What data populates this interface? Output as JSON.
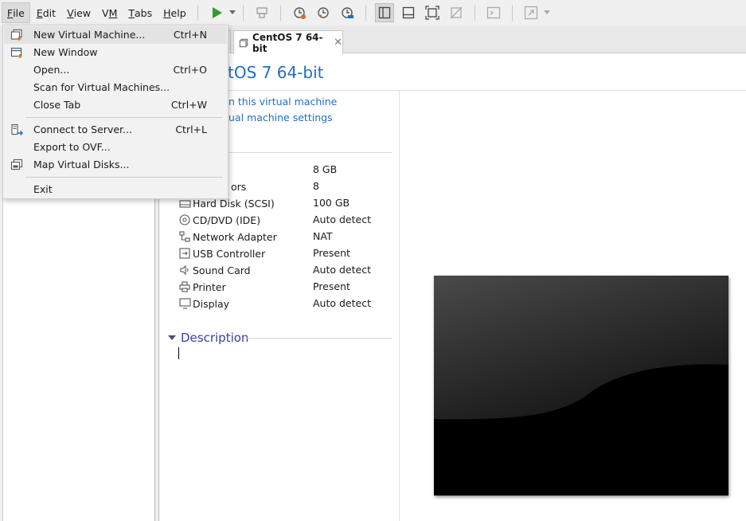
{
  "menubar": {
    "items": [
      {
        "prefix": "",
        "underline": "F",
        "rest": "ile"
      },
      {
        "prefix": "",
        "underline": "E",
        "rest": "dit"
      },
      {
        "prefix": "",
        "underline": "V",
        "rest": "iew"
      },
      {
        "prefix": "V",
        "underline": "M",
        "rest": ""
      },
      {
        "prefix": "",
        "underline": "T",
        "rest": "abs"
      },
      {
        "prefix": "",
        "underline": "H",
        "rest": "elp"
      }
    ]
  },
  "toolbar": {
    "play_color": "#2e9e2e",
    "icons": [
      "power-on-icon",
      "suspend-icon",
      "snapshot-icon",
      "revert-snapshot-icon",
      "manage-snapshots-icon",
      "show-library-icon",
      "thumbnail-bar-icon",
      "fit-guest-icon",
      "unity-icon",
      "console-view-icon",
      "fullscreen-icon"
    ]
  },
  "tab": {
    "label": "CentOS 7 64-bit",
    "close": "✕"
  },
  "vm": {
    "title": "tOS 7 64-bit",
    "actions": [
      "n this virtual machine",
      "ual machine settings"
    ]
  },
  "devices": [
    {
      "name": "",
      "value": "8 GB",
      "icon": "memory-icon"
    },
    {
      "name": "ors",
      "value": "8",
      "icon": "processor-icon"
    },
    {
      "name": "Hard Disk (SCSI)",
      "value": "100 GB",
      "icon": "hard-disk-icon"
    },
    {
      "name": "CD/DVD (IDE)",
      "value": "Auto detect",
      "icon": "cd-dvd-icon"
    },
    {
      "name": "Network Adapter",
      "value": "NAT",
      "icon": "network-adapter-icon"
    },
    {
      "name": "USB Controller",
      "value": "Present",
      "icon": "usb-icon"
    },
    {
      "name": "Sound Card",
      "value": "Auto detect",
      "icon": "sound-card-icon"
    },
    {
      "name": "Printer",
      "value": "Present",
      "icon": "printer-icon"
    },
    {
      "name": "Display",
      "value": "Auto detect",
      "icon": "display-icon"
    }
  ],
  "description": {
    "heading": "Description"
  },
  "file_menu": {
    "items": [
      {
        "label": "New Virtual Machine...",
        "shortcut": "Ctrl+N",
        "icon": "new-vm-icon"
      },
      {
        "label": "New Window",
        "shortcut": "",
        "icon": "new-window-icon"
      },
      {
        "label": "Open...",
        "shortcut": "Ctrl+O",
        "icon": ""
      },
      {
        "label": "Scan for Virtual Machines...",
        "shortcut": "",
        "icon": ""
      },
      {
        "label": "Close Tab",
        "shortcut": "Ctrl+W",
        "icon": ""
      },
      {
        "label": "Connect to Server...",
        "shortcut": "Ctrl+L",
        "icon": "connect-server-icon"
      },
      {
        "label": "Export to OVF...",
        "shortcut": "",
        "icon": ""
      },
      {
        "label": "Map Virtual Disks...",
        "shortcut": "",
        "icon": "map-disks-icon"
      },
      {
        "label": "Exit",
        "shortcut": "",
        "icon": ""
      }
    ]
  }
}
